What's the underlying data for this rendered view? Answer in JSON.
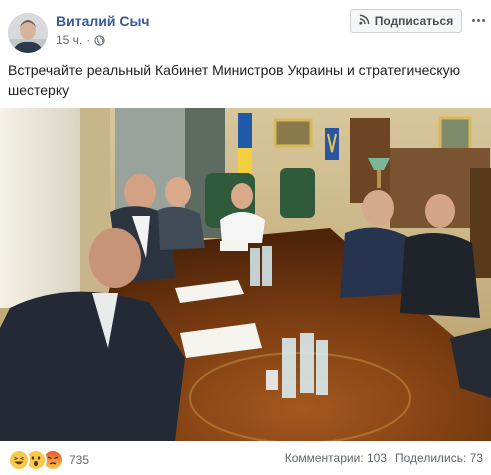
{
  "post": {
    "author": "Виталий Сыч",
    "time": "15 ч.",
    "separator": "·",
    "subscribe_label": "Подписаться",
    "text": "Встречайте реальный Кабинет Министров Украины и стратегическую шестерку"
  },
  "footer": {
    "reaction_count": "735",
    "comments": "Комментарии: 103",
    "shares": "Поделились: 73"
  },
  "colors": {
    "link_blue": "#385898",
    "meta_gray": "#616770",
    "text_dark": "#1c1e21"
  },
  "icons": [
    "globe-icon",
    "rss-icon",
    "more-icon",
    "haha-icon",
    "wow-icon",
    "angry-icon"
  ]
}
